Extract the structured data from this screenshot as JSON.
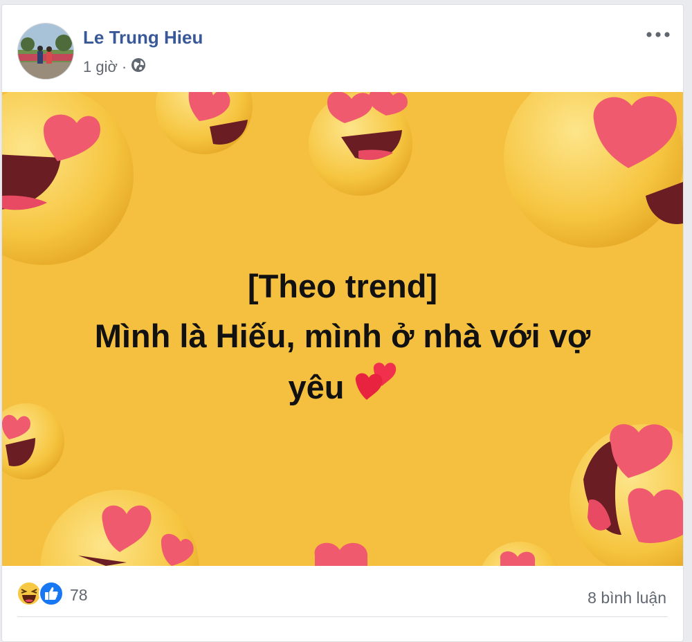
{
  "post": {
    "author_name": "Le Trung Hieu",
    "time": "1 giờ",
    "privacy_icon": "globe-icon",
    "more_icon": "more-horizontal-icon"
  },
  "banner": {
    "line1": "[Theo trend]",
    "line2": "Mình là Hiếu, mình ở nhà với vợ",
    "line3": "yêu",
    "emoji": "two-hearts-emoji",
    "background_color": "#f5bf3f"
  },
  "footer": {
    "reaction_icons": [
      "haha-icon",
      "like-icon"
    ],
    "reaction_count": "78",
    "comments": "8 bình luận"
  }
}
